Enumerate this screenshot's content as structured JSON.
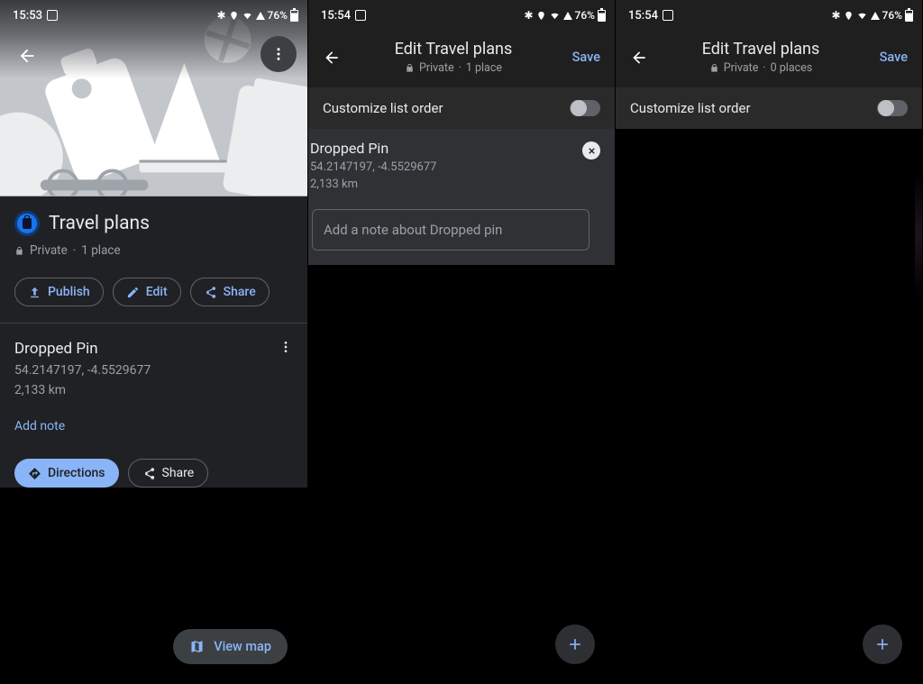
{
  "status": {
    "time1": "15:53",
    "time2": "15:54",
    "battery": "76%"
  },
  "panel1": {
    "title": "Travel plans",
    "privacy": "Private",
    "count": "1 place",
    "publish": "Publish",
    "edit": "Edit",
    "share": "Share",
    "place": {
      "title": "Dropped Pin",
      "coords": "54.2147197, -4.5529677",
      "distance": "2,133 km",
      "add_note": "Add note",
      "directions": "Directions",
      "share": "Share"
    },
    "view_map": "View map"
  },
  "panel2": {
    "title": "Edit Travel plans",
    "privacy": "Private",
    "count": "1 place",
    "save": "Save",
    "customize": "Customize list order",
    "pin": {
      "title": "Dropped Pin",
      "coords": "54.2147197, -4.5529677",
      "distance": "2,133 km",
      "note_placeholder": "Add a note about Dropped pin"
    }
  },
  "panel3": {
    "title": "Edit Travel plans",
    "privacy": "Private",
    "count": "0 places",
    "save": "Save",
    "customize": "Customize list order"
  }
}
